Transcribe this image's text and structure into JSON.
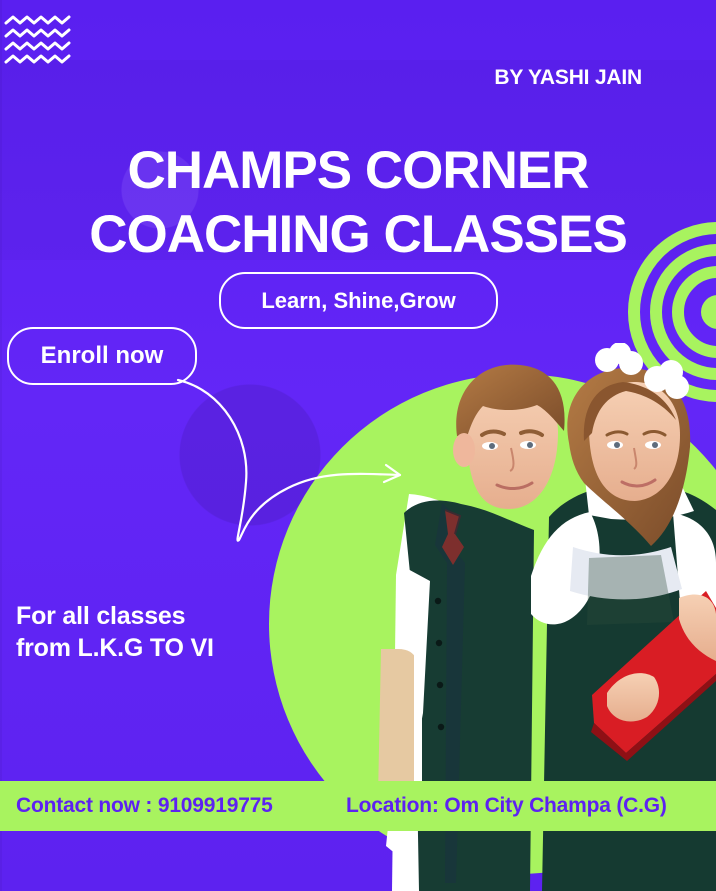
{
  "poster": {
    "byline": "BY YASHI JAIN",
    "title_line_1": "CHAMPS CORNER",
    "title_line_2": "COACHING CLASSES",
    "tagline": "Learn, Shine,Grow",
    "enroll_button": "Enroll now",
    "classes_line_1": "For all classes",
    "classes_line_2": "from L.K.G TO VI",
    "contact": "Contact now : 9109919775",
    "location": "Location: Om City Champa (C.G)"
  },
  "colors": {
    "background": "#5d21f2",
    "accent_green": "#a8f35f",
    "text_white": "#ffffff",
    "boy_vest": "#173c33",
    "girl_book": "#d91d24",
    "boy_book": "#e6c9a2"
  },
  "icons": {
    "zigzag": "zigzag-lines-icon",
    "spiral": "concentric-rings-icon",
    "arrow": "curved-arrow-icon"
  }
}
